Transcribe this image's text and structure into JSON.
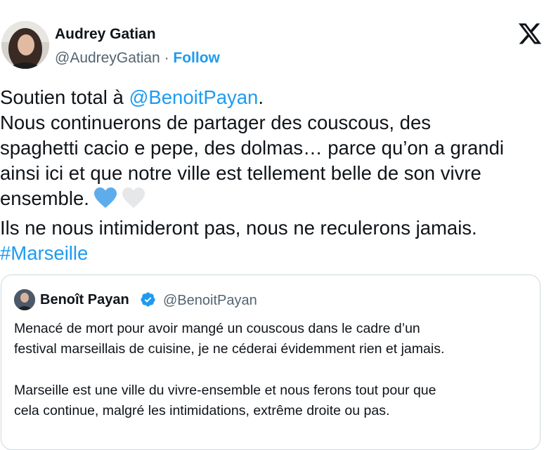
{
  "author": {
    "name": "Audrey Gatian",
    "handle": "@AudreyGatian",
    "separator": " · ",
    "follow_label": "Follow"
  },
  "tweet": {
    "line1_prefix": "Soutien total à ",
    "line1_mention": "@BenoitPayan",
    "line1_suffix": ".",
    "line2": "Nous continuerons de partager des couscous, des",
    "line3": "spaghetti cacio e pepe, des dolmas… parce qu’on a grandi",
    "line4": "ainsi ici et que notre ville est tellement belle de son vivre",
    "line5": "ensemble.",
    "line6": "Ils ne nous intimideront pas, nous ne reculerons jamais.",
    "hashtag": "#Marseille",
    "emojis": [
      "blue-heart-icon",
      "white-heart-icon"
    ]
  },
  "quoted": {
    "name": "Benoît Payan",
    "handle": "@BenoitPayan",
    "para1_line1": "Menacé de mort pour avoir mangé un couscous dans le cadre d’un",
    "para1_line2": "festival marseillais de cuisine, je ne céderai évidemment rien et jamais.",
    "para2_line1": "Marseille est une ville du vivre-ensemble et nous ferons tout pour que",
    "para2_line2": "cela continue, malgré les intimidations, extrême droite ou pas."
  },
  "colors": {
    "link": "#1d9bf0",
    "secondary_text": "#536471",
    "border": "#cfd9de",
    "verified_badge": "#1d9bf0"
  },
  "icons": [
    "x-logo-icon",
    "verified-badge-icon"
  ]
}
